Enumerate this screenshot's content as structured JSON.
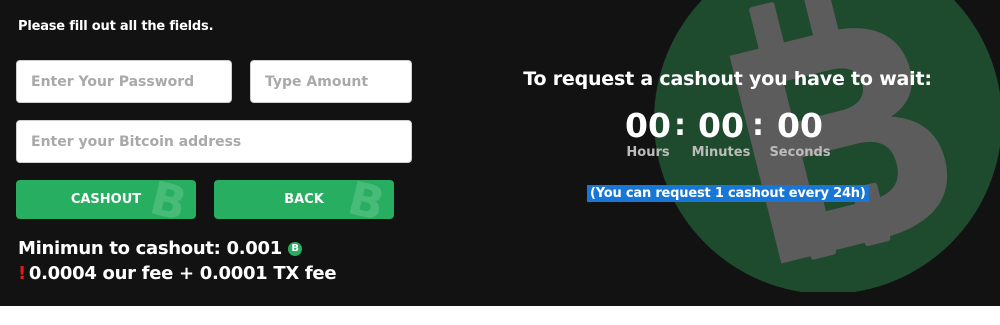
{
  "form": {
    "instruction": "Please fill out all the fields.",
    "password": {
      "placeholder": "Enter Your Password",
      "value": ""
    },
    "amount": {
      "placeholder": "Type Amount",
      "value": ""
    },
    "bitcoin_address": {
      "placeholder": "Enter your Bitcoin address",
      "value": ""
    },
    "cashout_label": "CASHOUT",
    "back_label": "BACK"
  },
  "info": {
    "minimum_text": "Minimun to cashout: 0.001",
    "coin_symbol": "B",
    "fee_warning_mark": "!",
    "fee_text": "0.0004 our fee + 0.0001 TX fee"
  },
  "countdown": {
    "title": "To request a cashout you have to wait:",
    "hours": "00",
    "minutes": "00",
    "seconds": "00",
    "separator": ":",
    "hours_label": "Hours",
    "minutes_label": "Minutes",
    "seconds_label": "Seconds",
    "note": "(You can request 1 cashout every 24h)"
  },
  "colors": {
    "background": "#121212",
    "accent_green": "#27ae60",
    "logo_circle": "#1e4a2d",
    "logo_mark": "#5c5c5c",
    "warning_red": "#e31b1b",
    "highlight_blue": "#1877d6"
  }
}
